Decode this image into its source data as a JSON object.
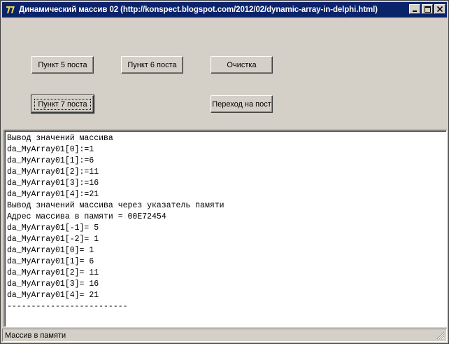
{
  "window": {
    "title": "Динамический массив 02 (http://konspect.blogspot.com/2012/02/dynamic-array-in-delphi.html)"
  },
  "icons": {
    "app": "delphi-app-icon",
    "minimize": "minimize-icon",
    "maximize": "maximize-icon",
    "close": "close-icon",
    "grip": "size-grip-icon"
  },
  "buttons": {
    "post5": "Пункт 5 поста",
    "post6": "Пункт 6 поста",
    "clear": "Очистка",
    "post7": "Пункт 7 поста",
    "goto_post": "Переход на пост"
  },
  "memo": {
    "lines": [
      "Вывод значений массива",
      "da_MyArray01[0]:=1",
      "da_MyArray01[1]:=6",
      "da_MyArray01[2]:=11",
      "da_MyArray01[3]:=16",
      "da_MyArray01[4]:=21",
      "Вывод значений массива через указатель памяти",
      "Адрес массива в памяти = 00E72454",
      "da_MyArray01[-1]= 5",
      "da_MyArray01[-2]= 1",
      "da_MyArray01[0]= 1",
      "da_MyArray01[1]= 6",
      "da_MyArray01[2]= 11",
      "da_MyArray01[3]= 16",
      "da_MyArray01[4]= 21",
      "-------------------------"
    ]
  },
  "statusbar": {
    "text": "Массив в памяти"
  },
  "colors": {
    "titlebar": "#0a246a",
    "face": "#d4d0c8"
  }
}
